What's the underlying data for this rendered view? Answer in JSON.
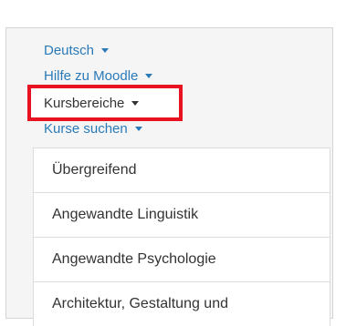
{
  "nav": {
    "language": "Deutsch",
    "help": "Hilfe zu Moodle",
    "course_areas": "Kursbereiche",
    "search_courses": "Kurse suchen"
  },
  "course_areas": {
    "items": [
      "Übergreifend",
      "Angewandte Linguistik",
      "Angewandte Psychologie",
      "Architektur, Gestaltung und"
    ]
  },
  "colors": {
    "link": "#2a7ab8",
    "highlight_border": "#e81220",
    "text": "#333333"
  }
}
